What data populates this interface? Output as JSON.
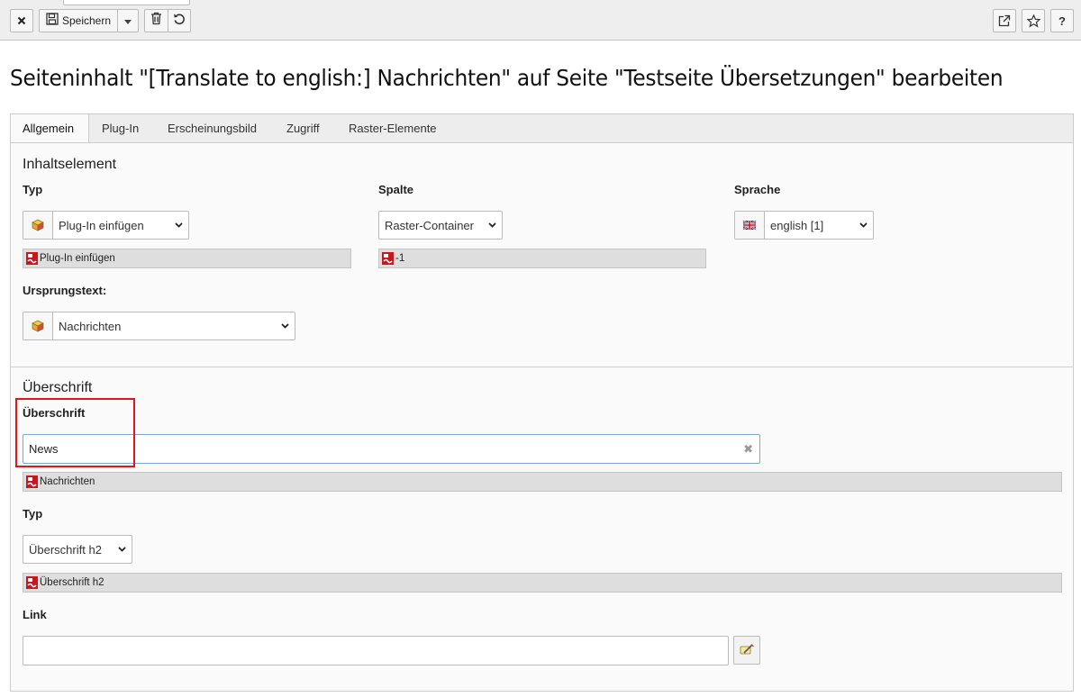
{
  "toolbar": {
    "close_icon": "close-icon",
    "save_label": "Speichern",
    "save_icon": "floppy-disk-icon",
    "save_menu_icon": "caret-down-icon",
    "delete_icon": "trash-icon",
    "undo_icon": "undo-icon",
    "open_new_window_icon": "external-window-icon",
    "bookmark_icon": "star-icon",
    "help_label": "?"
  },
  "page": {
    "title": "Seiteninhalt \"[Translate to english:] Nachrichten\" auf Seite \"Testseite Übersetzungen\" bearbeiten"
  },
  "tabs": [
    {
      "label": "Allgemein",
      "active": true
    },
    {
      "label": "Plug-In",
      "active": false
    },
    {
      "label": "Erscheinungsbild",
      "active": false
    },
    {
      "label": "Zugriff",
      "active": false
    },
    {
      "label": "Raster-Elemente",
      "active": false
    }
  ],
  "content_element": {
    "section_title": "Inhaltselement",
    "type": {
      "label": "Typ",
      "value": "Plug-In einfügen",
      "icon": "plugin-box-icon",
      "original_value": "Plug-In einfügen"
    },
    "column": {
      "label": "Spalte",
      "value": "Raster-Container",
      "original_value": "-1"
    },
    "language": {
      "label": "Sprache",
      "value": "english [1]",
      "icon": "uk-flag-icon"
    },
    "source_text": {
      "label": "Ursprungstext:",
      "value": "Nachrichten",
      "icon": "plugin-box-icon"
    }
  },
  "header": {
    "section_title": "Überschrift",
    "header_field": {
      "label": "Überschrift",
      "value": "News",
      "original_value": "Nachrichten"
    },
    "type": {
      "label": "Typ",
      "value": "Überschrift h2",
      "original_value": "Überschrift h2"
    },
    "link": {
      "label": "Link",
      "value": "",
      "wizard_icon": "link-wizard-icon"
    }
  },
  "colors": {
    "highlight": "#e0161b",
    "focus_border": "#7ea8d6",
    "original_marker": "#c8161d"
  }
}
